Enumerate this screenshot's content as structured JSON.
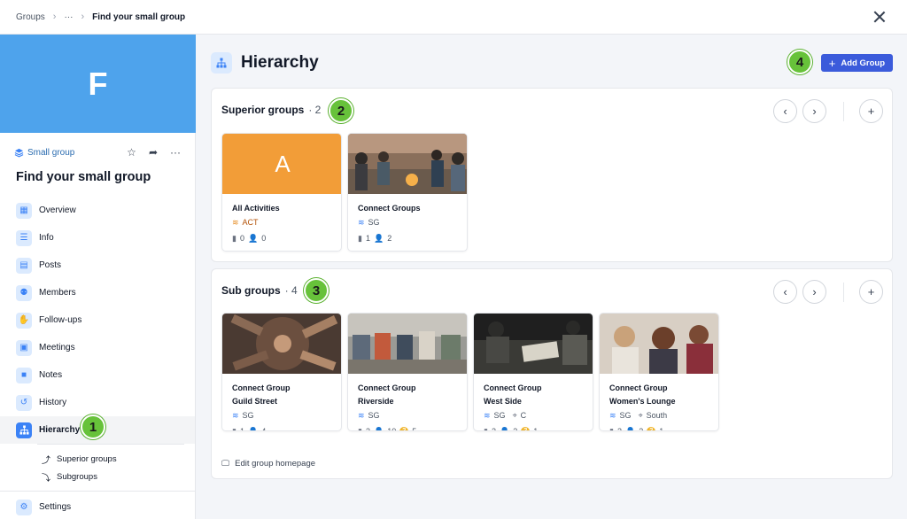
{
  "breadcrumb": {
    "root": "Groups",
    "ellipsis": "···",
    "current": "Find your small group"
  },
  "sidebar": {
    "cover_letter": "F",
    "group_type": "Small group",
    "group_title": "Find your small group",
    "nav": [
      {
        "label": "Overview",
        "icon": "grid-icon"
      },
      {
        "label": "Info",
        "icon": "list-icon"
      },
      {
        "label": "Posts",
        "icon": "news-icon"
      },
      {
        "label": "Members",
        "icon": "people-icon"
      },
      {
        "label": "Follow-ups",
        "icon": "handshake-icon"
      },
      {
        "label": "Meetings",
        "icon": "calendar-icon"
      },
      {
        "label": "Notes",
        "icon": "note-icon"
      },
      {
        "label": "History",
        "icon": "history-icon"
      },
      {
        "label": "Hierarchy",
        "icon": "hierarchy-icon"
      }
    ],
    "sub_nav": [
      {
        "label": "Superior groups",
        "icon": "arrow-up-icon"
      },
      {
        "label": "Subgroups",
        "icon": "arrow-down-icon"
      }
    ],
    "settings": "Settings"
  },
  "main": {
    "title": "Hierarchy",
    "add_button": "Add Group",
    "superior": {
      "label": "Superior groups",
      "count": "· 2",
      "cards": [
        {
          "letter": "A",
          "name1": "All Activities",
          "name2": "",
          "type": "ACT",
          "location": "",
          "stat_a": "0",
          "stat_b": "0",
          "stat_c": ""
        },
        {
          "name1": "Connect Groups",
          "name2": "",
          "type": "SG",
          "location": "",
          "stat_a": "1",
          "stat_b": "2",
          "stat_c": ""
        }
      ]
    },
    "sub": {
      "label": "Sub groups",
      "count": "· 4",
      "cards": [
        {
          "name1": "Connect Group",
          "name2": "Guild Street",
          "type": "SG",
          "location": "",
          "stat_a": "1",
          "stat_b": "4",
          "stat_c": ""
        },
        {
          "name1": "Connect Group",
          "name2": "Riverside",
          "type": "SG",
          "location": "",
          "stat_a": "3",
          "stat_b": "10",
          "stat_c": "5"
        },
        {
          "name1": "Connect Group",
          "name2": "West Side",
          "type": "SG",
          "location": "C",
          "stat_a": "2",
          "stat_b": "3",
          "stat_c": "1"
        },
        {
          "name1": "Connect Group",
          "name2": "Women's Lounge",
          "type": "SG",
          "location": "South",
          "stat_a": "2",
          "stat_b": "2",
          "stat_c": "1"
        }
      ],
      "edit_link": "Edit group homepage"
    }
  },
  "callouts": [
    "1",
    "2",
    "3",
    "4"
  ],
  "colors": {
    "accent": "#3b5bdb",
    "cover": "#4ea3ec",
    "activity_orange": "#f29d38",
    "callout_green": "#67c23a"
  }
}
